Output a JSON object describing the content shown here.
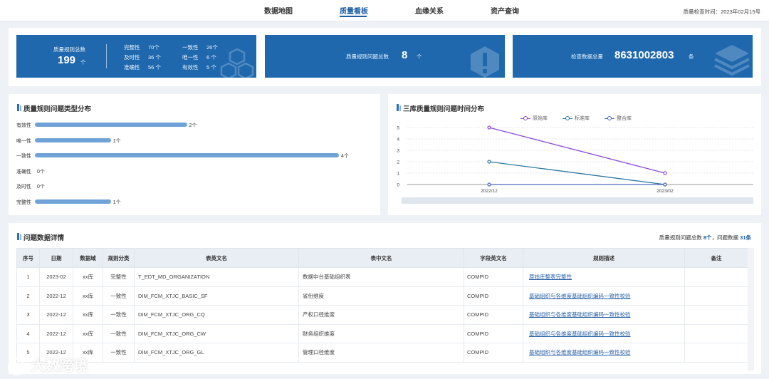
{
  "nav": {
    "tabs": [
      {
        "label": "数据地图",
        "active": false
      },
      {
        "label": "质量看板",
        "active": true
      },
      {
        "label": "血缘关系",
        "active": false
      },
      {
        "label": "资产查询",
        "active": false
      }
    ],
    "check_date": "质量检查时间：2023年02月15号"
  },
  "stats": {
    "rules": {
      "label": "质量规则总数",
      "value": "199",
      "unit": "个",
      "breakdown": [
        {
          "label": "完整性",
          "value": "70个"
        },
        {
          "label": "一致性",
          "value": "26个"
        },
        {
          "label": "及时性",
          "value": "36 个"
        },
        {
          "label": "唯一性",
          "value": "6 个"
        },
        {
          "label": "准确性",
          "value": "56 个"
        },
        {
          "label": "有效性",
          "value": "5 个"
        }
      ],
      "icon": "cubes-icon"
    },
    "issues": {
      "label": "质量规则问题总数",
      "value": "8",
      "unit": "个",
      "icon": "warning-hexagon-icon"
    },
    "checked": {
      "label": "检查数据总量",
      "value": "8631002803",
      "unit": "条",
      "icon": "layers-icon"
    }
  },
  "bar_section": {
    "title": "质量规则问题类型分布"
  },
  "line_section": {
    "title": "三库质量规则问题时间分布"
  },
  "chart_data": [
    {
      "type": "bar",
      "orientation": "horizontal",
      "title": "质量规则问题类型分布",
      "categories": [
        "有效性",
        "唯一性",
        "一致性",
        "准确性",
        "及时性",
        "完整性"
      ],
      "values": [
        2,
        1,
        4,
        0,
        0,
        1
      ],
      "value_labels": [
        "2个",
        "1个",
        "4个",
        "0个",
        "0个",
        "1个"
      ],
      "color": "#6fa3d8"
    },
    {
      "type": "line",
      "title": "三库质量规则问题时间分布",
      "x": [
        "2022/12",
        "2023/02"
      ],
      "y_ticks": [
        "0",
        "1",
        "2",
        "3",
        "4",
        "5"
      ],
      "ylim": [
        0,
        5
      ],
      "grid": true,
      "legend_position": "top-center",
      "series": [
        {
          "name": "原始库",
          "values": [
            5,
            1
          ],
          "color": "#8e4bd8"
        },
        {
          "name": "标准库",
          "values": [
            2,
            0
          ],
          "color": "#2b7a9e"
        },
        {
          "name": "整合库",
          "values": [
            0,
            0
          ],
          "color": "#4a66c4"
        }
      ]
    }
  ],
  "table_section": {
    "title": "问题数据详情",
    "summary_prefix": "质量规则问题总数",
    "summary_issues": "8个",
    "summary_mid": "，问题数据",
    "summary_rows": "31条",
    "columns": [
      "序号",
      "日期",
      "数据域",
      "规则分类",
      "表英文名",
      "表中文名",
      "字段英文名",
      "规则描述",
      "备注"
    ],
    "rows": [
      [
        "1",
        "2023-02",
        "xx库",
        "完整性",
        "T_EDT_MD_ORGANIZATION",
        "数据中台基础组织表",
        "COMPID",
        "原始库整表完整性",
        ""
      ],
      [
        "2",
        "2022-12",
        "xx库",
        "一致性",
        "DIM_FCM_XTJC_BASIC_SF",
        "省份维度",
        "COMPID",
        "基础组织与各维度基础组织编码一致性校验",
        ""
      ],
      [
        "3",
        "2022-12",
        "xx库",
        "一致性",
        "DIM_FCM_XTJC_ORG_CQ",
        "产权口径维度",
        "COMPID",
        "基础组织与各维度基础组织编码一致性校验",
        ""
      ],
      [
        "4",
        "2022-12",
        "xx库",
        "一致性",
        "DIM_FCM_XTJC_ORG_CW",
        "财务组织维度",
        "COMPID",
        "基础组织与各维度基础组织编码一致性校验",
        ""
      ],
      [
        "5",
        "2022-12",
        "xx库",
        "一致性",
        "DIM_FCM_XTJC_ORG_GL",
        "管理口径维度",
        "COMPID",
        "基础组织与各维度基础组织编码一致性校验",
        ""
      ]
    ]
  },
  "watermark": "大数跨境"
}
